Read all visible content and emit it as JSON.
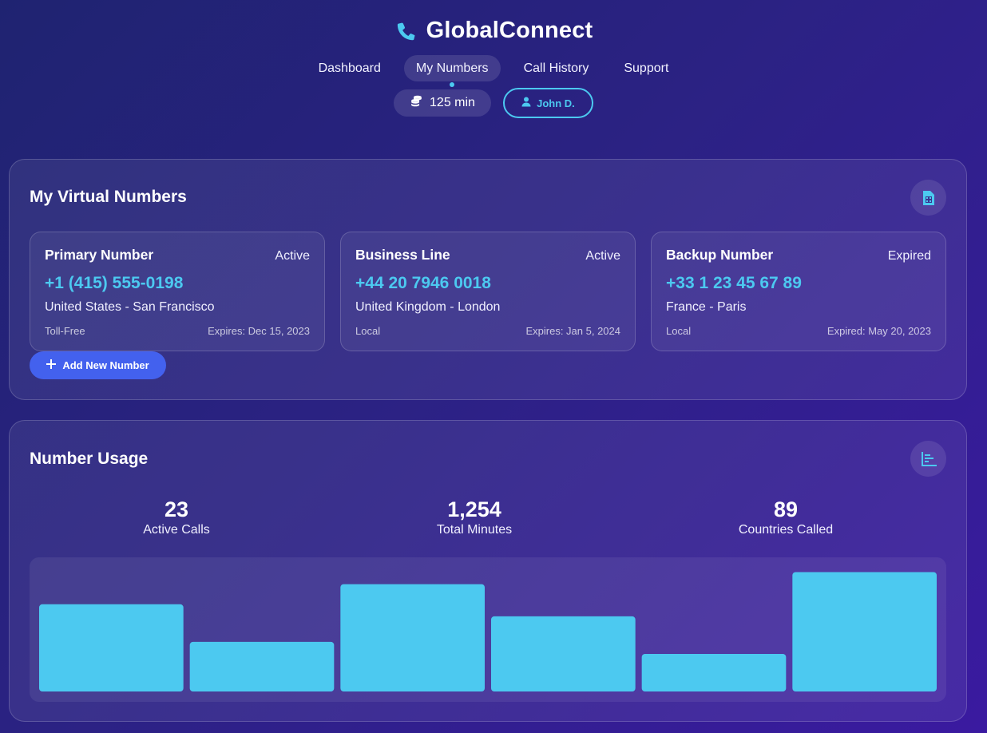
{
  "app": {
    "title": "GlobalConnect",
    "accent_color": "#4cc9f0",
    "primary_button_color": "#4361ee",
    "icon": "phone-icon"
  },
  "nav": {
    "items": [
      {
        "label": "Dashboard",
        "active": false
      },
      {
        "label": "My Numbers",
        "active": true
      },
      {
        "label": "Call History",
        "active": false
      },
      {
        "label": "Support",
        "active": false
      }
    ]
  },
  "balance": {
    "label": "125 min",
    "icon": "coins-icon"
  },
  "user": {
    "label": "John D.",
    "icon": "user-icon"
  },
  "numbers_section": {
    "title": "My Virtual Numbers",
    "icon": "sim-card-icon",
    "cards": [
      {
        "name": "Primary Number",
        "status": "Active",
        "phone": "+1 (415) 555-0198",
        "location": "United States - San Francisco",
        "type": "Toll-Free",
        "expiry": "Expires: Dec 15, 2023"
      },
      {
        "name": "Business Line",
        "status": "Active",
        "phone": "+44 20 7946 0018",
        "location": "United Kingdom - London",
        "type": "Local",
        "expiry": "Expires: Jan 5, 2024"
      },
      {
        "name": "Backup Number",
        "status": "Expired",
        "phone": "+33 1 23 45 67 89",
        "location": "France - Paris",
        "type": "Local",
        "expiry": "Expired: May 20, 2023"
      }
    ],
    "add_button": {
      "label": "Add New Number",
      "icon": "plus-icon"
    }
  },
  "usage_section": {
    "title": "Number Usage",
    "icon": "bar-chart-icon",
    "stats": [
      {
        "value": "23",
        "label": "Active Calls"
      },
      {
        "value": "1,254",
        "label": "Total Minutes"
      },
      {
        "value": "89",
        "label": "Countries Called"
      }
    ]
  },
  "chart_data": {
    "type": "bar",
    "values": [
      65,
      37,
      80,
      56,
      28,
      89
    ],
    "ylim": [
      0,
      100
    ],
    "bar_color": "#4cc9f0",
    "grid": false,
    "title": "",
    "xlabel": "",
    "ylabel": ""
  }
}
